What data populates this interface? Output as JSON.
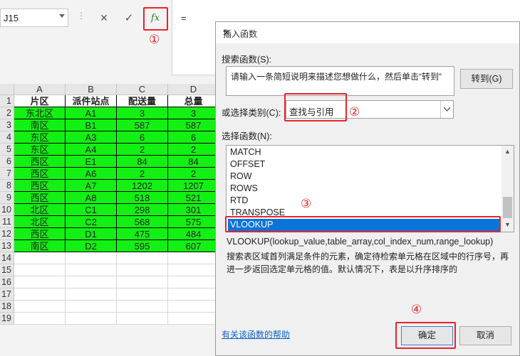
{
  "formula_bar": {
    "name_box": "J15",
    "dots": "⋮",
    "cancel_icon": "✕",
    "enter_icon": "✓",
    "fx_label": "fx",
    "formula": "="
  },
  "annotations": [
    "①",
    "②",
    "③",
    "④"
  ],
  "sheet": {
    "columns": [
      "A",
      "B",
      "C",
      "D"
    ],
    "rows": [
      "1",
      "2",
      "3",
      "4",
      "5",
      "6",
      "7",
      "8",
      "9",
      "10",
      "11",
      "12",
      "13",
      "14",
      "15",
      "16",
      "17",
      "18",
      "19"
    ],
    "header": [
      "片区",
      "派件站点",
      "配送量",
      "总量"
    ],
    "data": [
      [
        "东北区",
        "A1",
        "3",
        "3"
      ],
      [
        "南区",
        "B1",
        "587",
        "587"
      ],
      [
        "东区",
        "A3",
        "6",
        "6"
      ],
      [
        "东区",
        "A4",
        "2",
        "2"
      ],
      [
        "西区",
        "E1",
        "84",
        "84"
      ],
      [
        "西区",
        "A6",
        "2",
        "2"
      ],
      [
        "西区",
        "A7",
        "1202",
        "1207"
      ],
      [
        "西区",
        "A8",
        "518",
        "521"
      ],
      [
        "北区",
        "C1",
        "298",
        "301"
      ],
      [
        "北区",
        "C2",
        "568",
        "575"
      ],
      [
        "西区",
        "D1",
        "475",
        "484"
      ],
      [
        "南区",
        "D2",
        "595",
        "607"
      ]
    ]
  },
  "dialog": {
    "title": "插入函数",
    "help": "?",
    "close": "✕",
    "search_label": "搜索函数(S):",
    "search_value": "请输入一条简短说明来描述您想做什么，然后单击“转到”",
    "go_button": "转到(G)",
    "category_label": "或选择类别(C):",
    "category_value": "查找与引用",
    "function_label": "选择函数(N):",
    "functions": [
      "MATCH",
      "OFFSET",
      "ROW",
      "ROWS",
      "RTD",
      "TRANSPOSE",
      "VLOOKUP"
    ],
    "selected_function": "VLOOKUP",
    "signature": "VLOOKUP(lookup_value,table_array,col_index_num,range_lookup)",
    "description": "搜索表区域首列满足条件的元素，确定待检索单元格在区域中的行序号，再进一步返回选定单元格的值。默认情况下，表是以升序排序的",
    "help_link": "有关该函数的帮助",
    "ok_button": "确定",
    "cancel_button": "取消"
  },
  "colors": {
    "green_fill": "#13f013",
    "highlight": "#e8232a",
    "selection": "#0a74d9"
  }
}
